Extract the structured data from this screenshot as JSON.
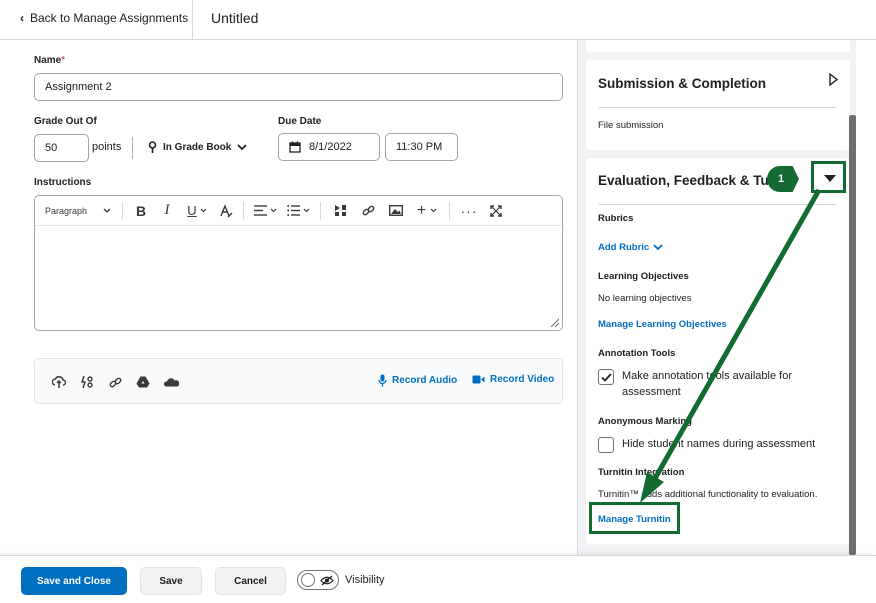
{
  "topbar": {
    "back_label": "Back to Manage Assignments",
    "title": "Untitled"
  },
  "form": {
    "name_label": "Name",
    "required_mark": "*",
    "name_value": "Assignment 2",
    "grade_label": "Grade Out Of",
    "grade_value": "50",
    "points_label": "points",
    "gradebook_label": "In Grade Book",
    "due_label": "Due Date",
    "due_date": "8/1/2022",
    "due_time": "11:30 PM",
    "instructions_label": "Instructions",
    "paragraph_label": "Paragraph"
  },
  "attachments": {
    "record_audio": "Record Audio",
    "record_video": "Record Video"
  },
  "panel": {
    "submission_title": "Submission & Completion",
    "submission_type": "File submission",
    "eval_title": "Evaluation, Feedback & Turnitin",
    "rubrics_label": "Rubrics",
    "add_rubric": "Add Rubric",
    "lo_label": "Learning Objectives",
    "lo_text": "No learning objectives",
    "manage_lo": "Manage Learning Objectives",
    "annotation_label": "Annotation Tools",
    "annotation_checkbox": "Make annotation tools available for assessment",
    "annotation_checked": true,
    "anon_label": "Anonymous Marking",
    "anon_checkbox": "Hide student names during assessment",
    "anon_checked": false,
    "turnitin_label": "Turnitin Integration",
    "turnitin_text": "Turnitin™ adds additional functionality to evaluation.",
    "manage_turnitin": "Manage Turnitin"
  },
  "annotation": {
    "step_number": "1",
    "color": "#136b32"
  },
  "footer": {
    "save_close": "Save and Close",
    "save": "Save",
    "cancel": "Cancel",
    "visibility": "Visibility"
  },
  "colors": {
    "primary": "#006fbf",
    "link": "#006fbf",
    "required": "#cd2026"
  }
}
